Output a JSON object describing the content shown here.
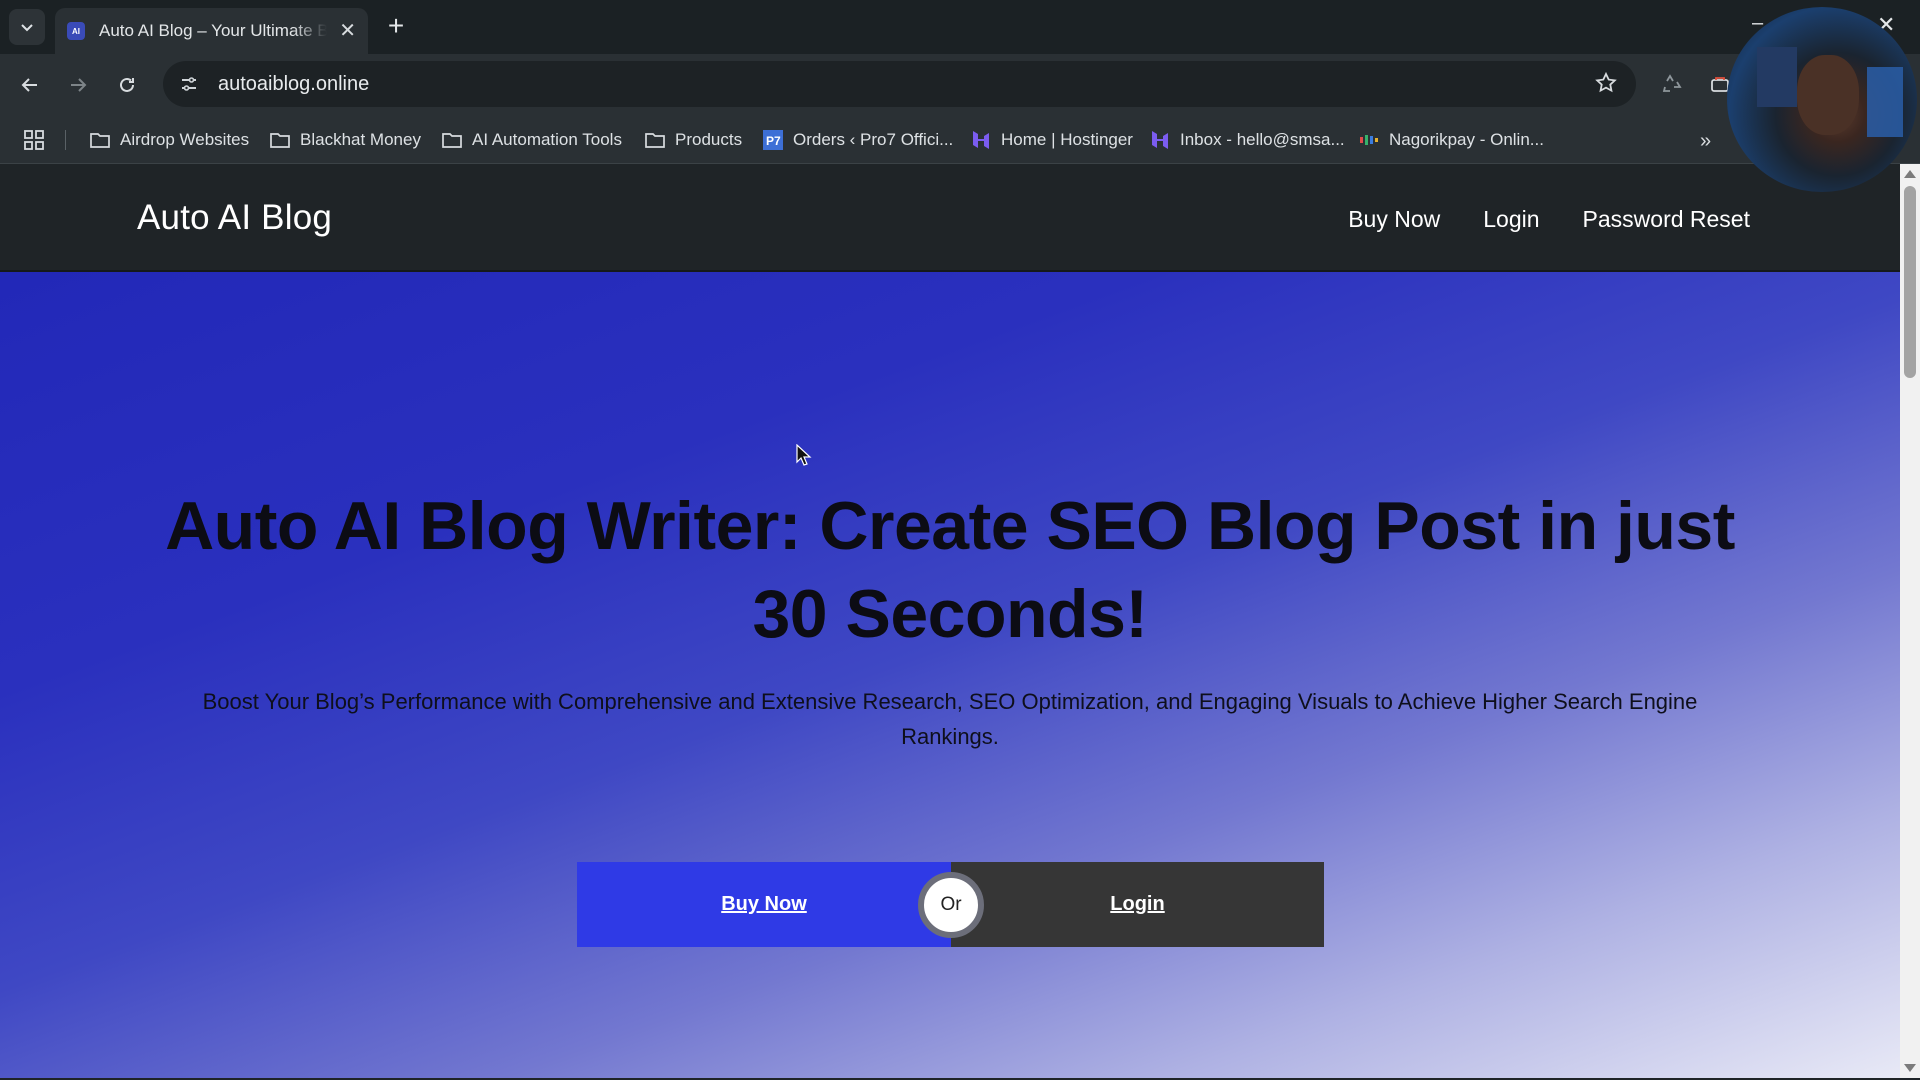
{
  "browser": {
    "tab_title": "Auto AI Blog – Your Ultimate Bl",
    "tab_favicon_text": "AI",
    "url": "autoaiblog.online",
    "bookmarks": [
      {
        "label": "Airdrop Websites",
        "icon": "folder-icon"
      },
      {
        "label": "Blackhat Money",
        "icon": "folder-icon"
      },
      {
        "label": "AI Automation Tools",
        "icon": "folder-icon"
      },
      {
        "label": "Products",
        "icon": "folder-icon"
      },
      {
        "label": "Orders ‹ Pro7 Offici...",
        "icon": "pro7-icon"
      },
      {
        "label": "Home | Hostinger",
        "icon": "hostinger-icon"
      },
      {
        "label": "Inbox - hello@smsa...",
        "icon": "hostinger-icon"
      },
      {
        "label": "Nagorikpay - Onlin...",
        "icon": "nagorikpay-icon"
      }
    ]
  },
  "site": {
    "logo": "Auto AI Blog",
    "nav": [
      "Buy Now",
      "Login",
      "Password Reset"
    ]
  },
  "hero": {
    "title_line1": "Auto AI Blog Writer: Create SEO Blog Post in just",
    "title_line2": "30 Seconds!",
    "subtitle_line1": "Boost Your Blog’s Performance with Comprehensive and Extensive Research, SEO Optimization, and Engaging Visuals to Achieve Higher Search Engine",
    "subtitle_line2": "Rankings.",
    "buy_label": "Buy Now",
    "or_label": "Or",
    "login_label": "Login"
  },
  "colors": {
    "cta_buy": "#2f3ae6",
    "cta_login": "#363636",
    "header_bg": "#1f2427",
    "hero_gradient_start": "#2228b8",
    "hero_gradient_end": "#e8e9f6"
  }
}
